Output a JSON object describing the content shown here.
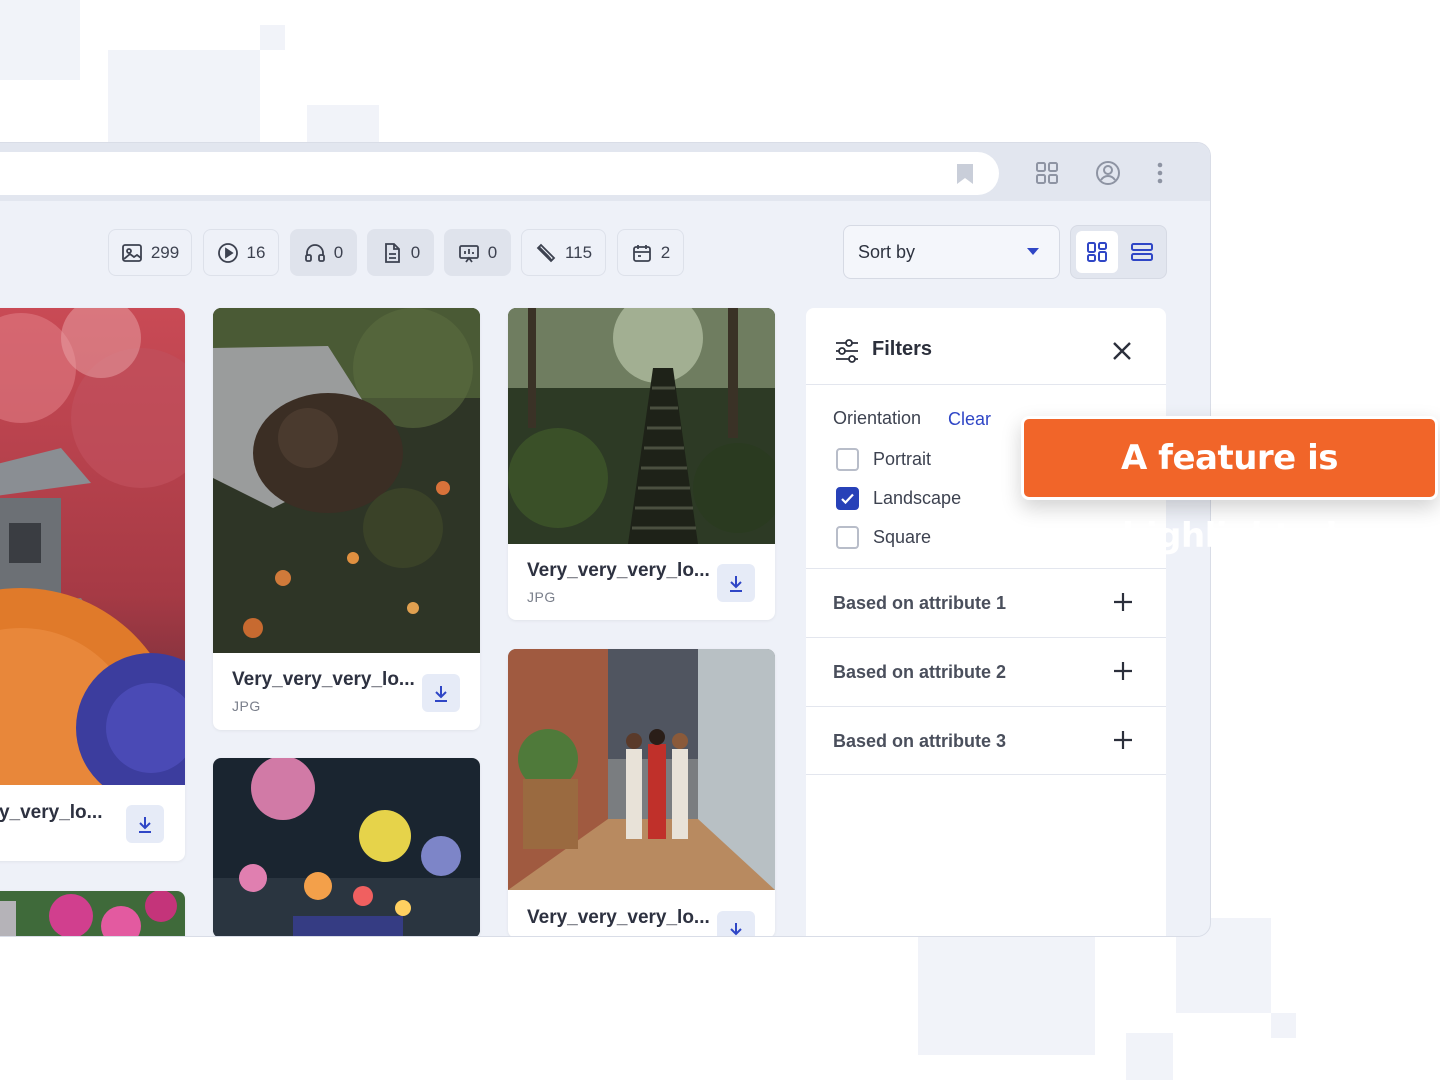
{
  "toolbar": {
    "chips": [
      {
        "icon": "image-icon",
        "count": "299"
      },
      {
        "icon": "play-icon",
        "count": "16"
      },
      {
        "icon": "headphones-icon",
        "count": "0"
      },
      {
        "icon": "document-icon",
        "count": "0"
      },
      {
        "icon": "presentation-icon",
        "count": "0"
      },
      {
        "icon": "brush-icon",
        "count": "115"
      },
      {
        "icon": "template-icon",
        "count": "2"
      }
    ],
    "sort_label": "Sort by",
    "view_modes": [
      "grid-view-icon",
      "list-view-icon"
    ]
  },
  "assets": [
    {
      "name": "ery_very_lo...",
      "type": ""
    },
    {
      "name": "Very_very_very_lo...",
      "type": "JPG"
    },
    {
      "name": "Very_very_very_lo...",
      "type": "JPG"
    },
    {
      "name": "Very_very_very_lo...",
      "type": ""
    }
  ],
  "filters": {
    "title": "Filters",
    "orientation_title": "Orientation",
    "clear_label": "Clear",
    "options": [
      {
        "label": "Portrait",
        "checked": false
      },
      {
        "label": "Landscape",
        "checked": true
      },
      {
        "label": "Square",
        "checked": false
      }
    ],
    "attributes": [
      "Based on attribute 1",
      "Based on attribute 2",
      "Based on attribute 3"
    ]
  },
  "callout": {
    "text": "A feature is highlighted"
  },
  "colors": {
    "accent": "#2f46c6",
    "callout": "#f16529",
    "checkbox": "#2741b8"
  }
}
